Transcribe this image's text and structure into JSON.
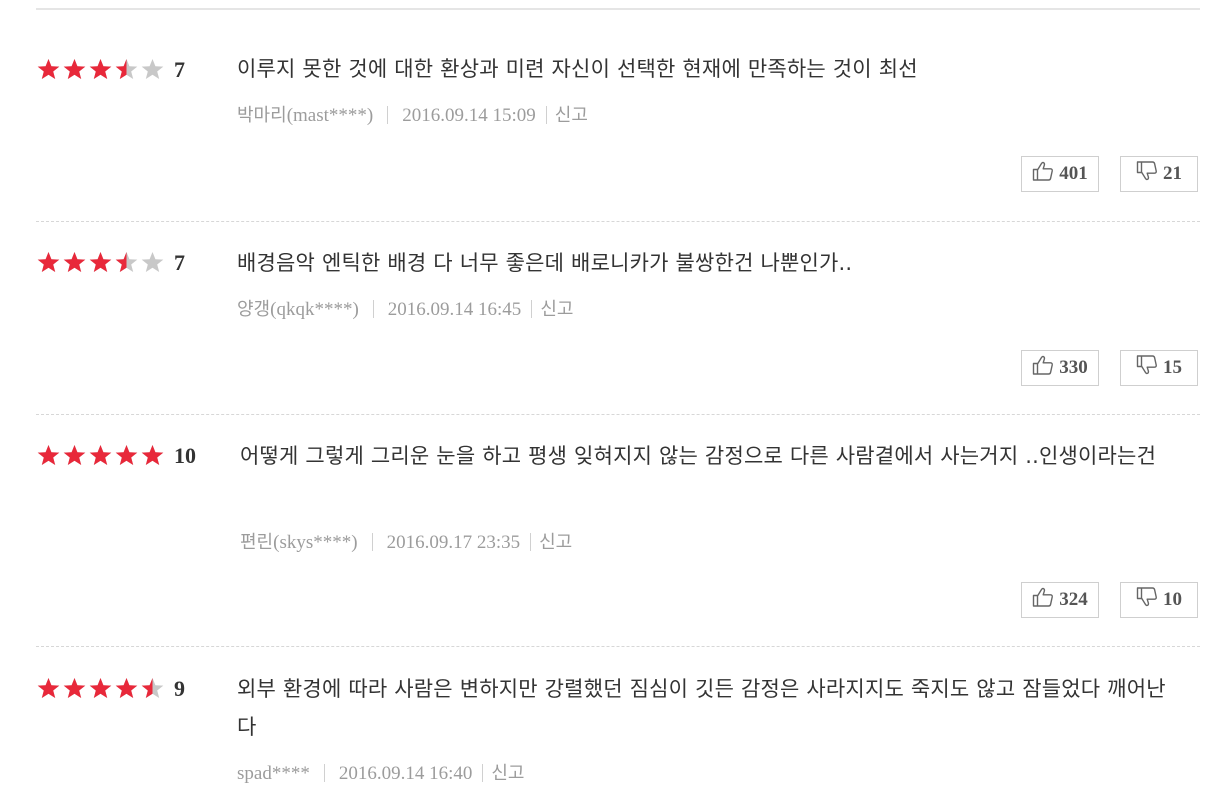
{
  "reviews": [
    {
      "rating_stars": 3.5,
      "score": "7",
      "comment": "이루지 못한 것에 대한 환상과 미련 자신이 선택한 현재에 만족하는 것이 최선",
      "writer_name": "박마리",
      "writer_id": "(mast****)",
      "date": "2016.09.14 15:09",
      "report_label": "신고",
      "like_count": "401",
      "dislike_count": "21"
    },
    {
      "rating_stars": 3.5,
      "score": "7",
      "comment": "배경음악 엔틱한 배경 다 너무 좋은데 배로니카가 불쌍한건 나뿐인가..",
      "writer_name": "양갱",
      "writer_id": "(qkqk****)",
      "date": "2016.09.14 16:45",
      "report_label": "신고",
      "like_count": "330",
      "dislike_count": "15"
    },
    {
      "rating_stars": 5,
      "score": "10",
      "comment": "어떻게 그렇게 그리운 눈을 하고 평생 잊혀지지 않는 감정으로 다른 사람곁에서 사는거지 ..인생이라는건",
      "writer_name": "편린",
      "writer_id": "(skys****)",
      "date": "2016.09.17 23:35",
      "report_label": "신고",
      "like_count": "324",
      "dislike_count": "10"
    },
    {
      "rating_stars": 4.5,
      "score": "9",
      "comment": "외부 환경에 따라 사람은 변하지만 강렬했던 짐심이 깃든 감정은 사라지지도 죽지도 않고 잠들었다 깨어난다",
      "writer_name": "",
      "writer_id": "spad****",
      "date": "2016.09.14 16:40",
      "report_label": "신고"
    }
  ],
  "colors": {
    "star_filled": "#e8283a",
    "star_empty": "#c8c8c8",
    "text": "#333333",
    "meta": "#9c9c9c"
  },
  "icons": {
    "like": "thumbs-up-icon",
    "dislike": "thumbs-down-icon"
  }
}
